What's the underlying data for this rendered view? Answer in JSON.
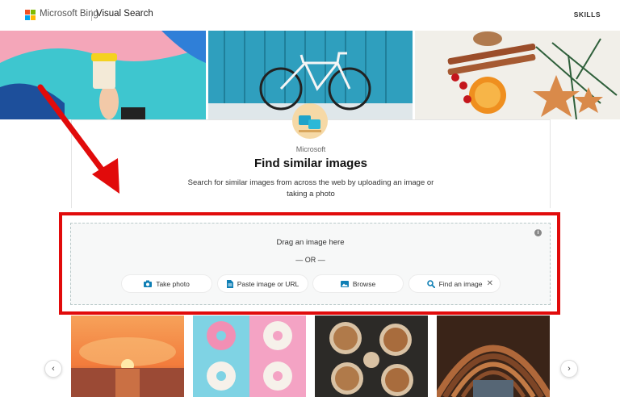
{
  "header": {
    "brand": "Microsoft Bing",
    "product": "Visual Search",
    "skills_label": "SKILLS",
    "logo_colors": [
      "#f25022",
      "#7fba00",
      "#00a4ef",
      "#ffb900"
    ]
  },
  "card": {
    "publisher": "Microsoft",
    "title": "Find similar images",
    "description": "Search for similar images from across the web by uploading an image or taking a photo"
  },
  "dropzone": {
    "drag_text": "Drag an image here",
    "or_text": "— OR —",
    "info_icon": "info-icon"
  },
  "actions": [
    {
      "label": "Take photo",
      "icon": "camera-icon"
    },
    {
      "label": "Paste image or URL",
      "icon": "document-icon"
    },
    {
      "label": "Browse",
      "icon": "image-icon"
    },
    {
      "label": "Find an image",
      "icon": "search-icon"
    }
  ],
  "accent_color": "#0f7fb5",
  "annotation_color": "#e10b0b"
}
